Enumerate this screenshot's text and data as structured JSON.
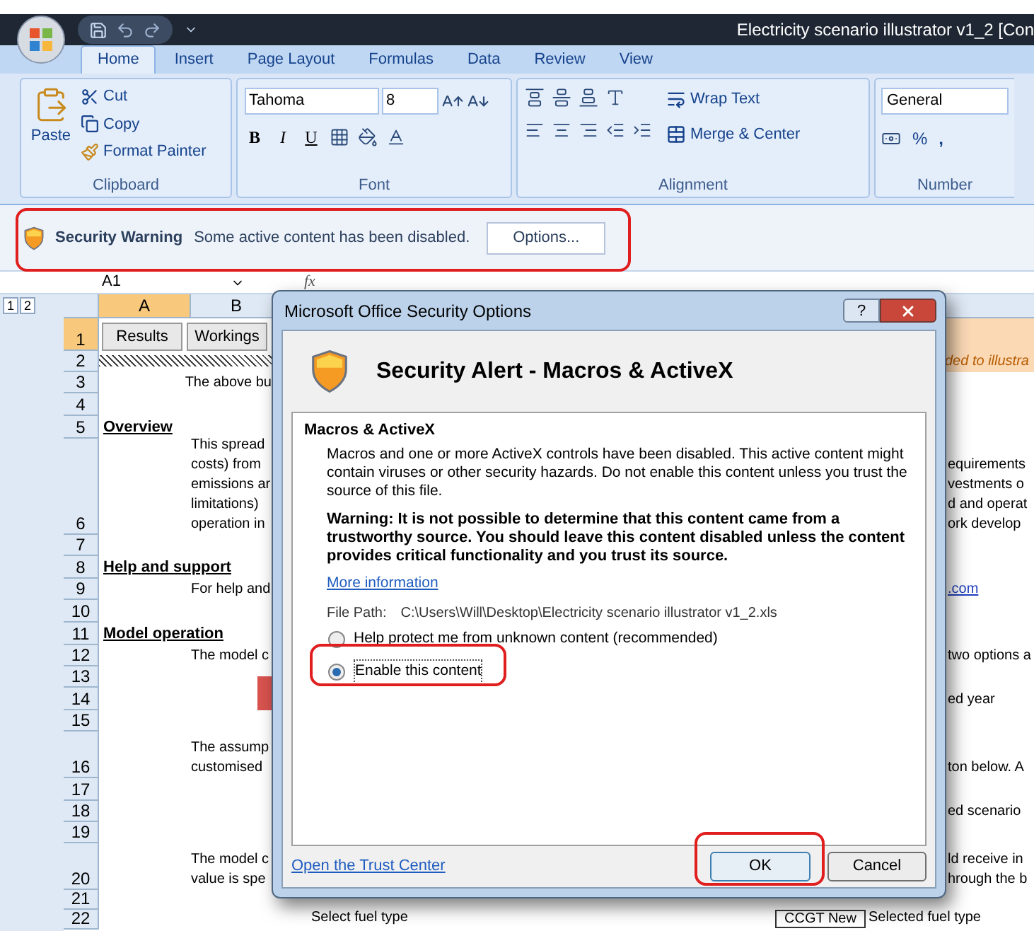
{
  "title_bar": {
    "title": "Electricity scenario illustrator v1_2  [Con"
  },
  "ribbon_tabs": [
    {
      "label": "Home",
      "selected": true
    },
    {
      "label": "Insert",
      "selected": false
    },
    {
      "label": "Page Layout",
      "selected": false
    },
    {
      "label": "Formulas",
      "selected": false
    },
    {
      "label": "Data",
      "selected": false
    },
    {
      "label": "Review",
      "selected": false
    },
    {
      "label": "View",
      "selected": false
    }
  ],
  "ribbon": {
    "clipboard": {
      "paste": "Paste",
      "cut": "Cut",
      "copy": "Copy",
      "format_painter": "Format Painter",
      "label": "Clipboard"
    },
    "font": {
      "name": "Tahoma",
      "size": "8",
      "bold": "B",
      "italic": "I",
      "underline": "U",
      "label": "Font"
    },
    "alignment": {
      "wrap": "Wrap Text",
      "merge": "Merge & Center",
      "label": "Alignment"
    },
    "number": {
      "format": "General",
      "percent": "%",
      "comma": ",",
      "label": "Number"
    }
  },
  "security_bar": {
    "title": "Security Warning",
    "message": "Some active content has been disabled.",
    "button": "Options..."
  },
  "formula_bar": {
    "name_box": "A1",
    "fx": "fx"
  },
  "sheet": {
    "outline_levels": [
      "1",
      "2"
    ],
    "columns": [
      {
        "label": "A",
        "selected": true
      },
      {
        "label": "B",
        "selected": false
      }
    ],
    "rows": [
      {
        "number": "1",
        "selected": true,
        "kind": "buttons",
        "buttons": [
          "Results",
          "Workings"
        ]
      },
      {
        "number": "2",
        "selected": false,
        "kind": "hatch",
        "note": "ded to illustra"
      },
      {
        "number": "3",
        "selected": false,
        "kind": "caption",
        "left": [
          "The above bu"
        ]
      },
      {
        "number": "4",
        "selected": false,
        "kind": "blank"
      },
      {
        "number": "5",
        "selected": false,
        "kind": "heading",
        "heading": "Overview"
      },
      {
        "number": "6",
        "selected": false,
        "kind": "text",
        "left": [
          "This spread",
          "costs) from",
          "emissions ar",
          "limitations)",
          "operation in"
        ],
        "right": [
          "equirements",
          "vestments o",
          "d and operat",
          "ork develop"
        ]
      },
      {
        "number": "7",
        "selected": false,
        "kind": "blank"
      },
      {
        "number": "8",
        "selected": false,
        "kind": "heading",
        "heading": "Help and support"
      },
      {
        "number": "9",
        "selected": false,
        "kind": "text",
        "left": [
          "For help and"
        ],
        "right_link": ".com"
      },
      {
        "number": "10",
        "selected": false,
        "kind": "blank"
      },
      {
        "number": "11",
        "selected": false,
        "kind": "heading",
        "heading": "Model operation"
      },
      {
        "number": "12",
        "selected": false,
        "kind": "text",
        "left": [
          "The model c"
        ],
        "right": [
          "two options a"
        ]
      },
      {
        "number": "13",
        "selected": false,
        "kind": "marker"
      },
      {
        "number": "14",
        "selected": false,
        "kind": "text",
        "right": [
          "ed year"
        ]
      },
      {
        "number": "15",
        "selected": false,
        "kind": "blank"
      },
      {
        "number": "16",
        "selected": false,
        "kind": "text",
        "left": [
          "The assump",
          "customised"
        ],
        "right": [
          "ton below.  A"
        ]
      },
      {
        "number": "17",
        "selected": false,
        "kind": "blank"
      },
      {
        "number": "18",
        "selected": false,
        "kind": "text",
        "right": [
          "ed scenario"
        ]
      },
      {
        "number": "19",
        "selected": false,
        "kind": "blank"
      },
      {
        "number": "20",
        "selected": false,
        "kind": "text",
        "left": [
          "The model c",
          "value is spe"
        ],
        "right": [
          "ld receive in",
          "hrough the b"
        ]
      },
      {
        "number": "21",
        "selected": false,
        "kind": "blank"
      },
      {
        "number": "22",
        "selected": false,
        "kind": "fuel",
        "fuel": {
          "label": "Select fuel type",
          "value": "CCGT New",
          "caption": "Selected fuel type"
        }
      }
    ]
  },
  "dialog": {
    "title": "Microsoft Office Security Options",
    "help": "?",
    "heading": "Security Alert - Macros & ActiveX",
    "section": "Macros & ActiveX",
    "description": "Macros and one or more ActiveX controls have been disabled. This active content might contain viruses or other security hazards. Do not enable this content unless you trust the source of this file.",
    "warning": "Warning: It is not possible to determine that this content came from a trustworthy source. You should leave this content disabled unless the content provides critical functionality and you trust its source.",
    "more_info": "More information",
    "file_path_label": "File Path:",
    "file_path": "C:\\Users\\Will\\Desktop\\Electricity scenario illustrator v1_2.xls",
    "options": [
      {
        "label": "Help protect me from unknown content (recommended)",
        "selected": false
      },
      {
        "label": "Enable this content",
        "selected": true
      }
    ],
    "trust_center": "Open the Trust Center",
    "ok": "OK",
    "cancel": "Cancel"
  }
}
